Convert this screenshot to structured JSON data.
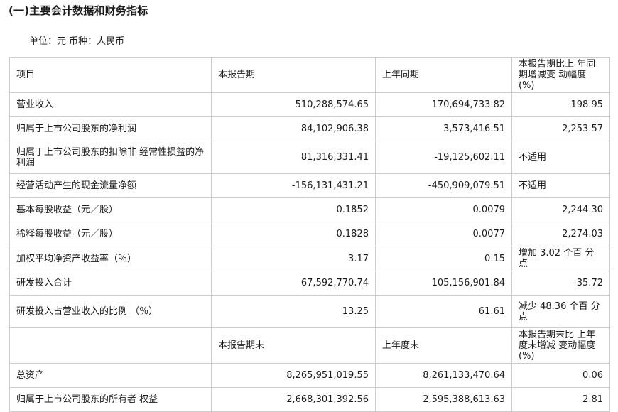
{
  "heading": "(一)主要会计数据和财务指标",
  "unit_line": "单位：元 币种：人民币",
  "header1": [
    "项目",
    "本报告期",
    "上年同期",
    "本报告期比上 年同期增减变 动幅度 (%)"
  ],
  "rows1": [
    [
      "营业收入",
      "510,288,574.65",
      "170,694,733.82",
      "198.95"
    ],
    [
      "归属于上市公司股东的净利润",
      "84,102,906.38",
      "3,573,416.51",
      "2,253.57"
    ],
    [
      "归属于上市公司股东的扣除非 经常性损益的净利润",
      "81,316,331.41",
      "-19,125,602.11",
      "不适用"
    ],
    [
      "经营活动产生的现金流量净额",
      "-156,131,431.21",
      "-450,909,079.51",
      "不适用"
    ],
    [
      "基本每股收益（元／股）",
      "0.1852",
      "0.0079",
      "2,244.30"
    ],
    [
      "稀释每股收益（元／股）",
      "0.1828",
      "0.0077",
      "2,274.03"
    ],
    [
      "加权平均净资产收益率（％）",
      "3.17",
      "0.15",
      "增加 3.02 个百 分点"
    ],
    [
      "研发投入合计",
      "67,592,770.74",
      "105,156,901.84",
      "-35.72"
    ],
    [
      "研发投入占营业收入的比例 （％）",
      "13.25",
      "61.61",
      "减少 48.36 个百 分点"
    ]
  ],
  "header2": [
    "",
    "本报告期末",
    "上年度末",
    "本报告期末比 上年度末增减 变动幅度(%)"
  ],
  "rows2": [
    [
      "总资产",
      "8,265,951,019.55",
      "8,261,133,470.64",
      "0.06"
    ],
    [
      "归属于上市公司股东的所有者 权益",
      "2,668,301,392.56",
      "2,595,388,613.63",
      "2.81"
    ]
  ]
}
